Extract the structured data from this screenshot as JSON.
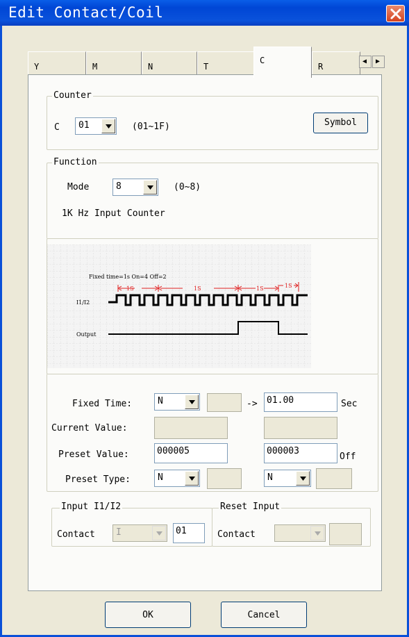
{
  "window": {
    "title": "Edit Contact/Coil"
  },
  "tabs": [
    {
      "label": "Y",
      "active": false
    },
    {
      "label": "M",
      "active": false
    },
    {
      "label": "N",
      "active": false
    },
    {
      "label": "T",
      "active": false
    },
    {
      "label": "C",
      "active": true
    },
    {
      "label": "R",
      "active": false
    }
  ],
  "counter": {
    "group_label": "Counter",
    "prefix": "C",
    "value": "01",
    "range": "(01~1F)",
    "symbol_button": "Symbol"
  },
  "function": {
    "group_label": "Function",
    "mode_label": "Mode",
    "mode_value": "8",
    "mode_range": "(0~8)",
    "description": "1K Hz Input Counter"
  },
  "timing_diagram": {
    "caption": "Fixed time=1s  On=4  Off=2",
    "interval_labels": [
      "1S",
      "1S",
      "1S",
      "1S"
    ],
    "signal_label_input": "I1/I2",
    "signal_label_output": "Output",
    "colors": {
      "interval": "#e02020",
      "signal": "#000000",
      "grid": "#c8c8c8"
    }
  },
  "fields": {
    "fixed_time_label": "Fixed Time:",
    "fixed_time_type": "N",
    "fixed_time_arrow": "->",
    "fixed_time_value": "01.00",
    "fixed_time_unit": "Sec",
    "current_value_label": "Current Value:",
    "preset_value_label": "Preset Value:",
    "preset_value_on": "000005",
    "preset_value_off": "000003",
    "preset_value_off_unit": "Off",
    "preset_type_label": "Preset Type:",
    "preset_type_on": "N",
    "preset_type_off": "N"
  },
  "input_group": {
    "label": "Input I1/I2",
    "contact_label": "Contact",
    "contact_type": "I",
    "contact_number": "01"
  },
  "reset_group": {
    "label": "Reset Input",
    "contact_label": "Contact",
    "contact_type": "",
    "contact_number": ""
  },
  "buttons": {
    "ok": "OK",
    "cancel": "Cancel"
  }
}
